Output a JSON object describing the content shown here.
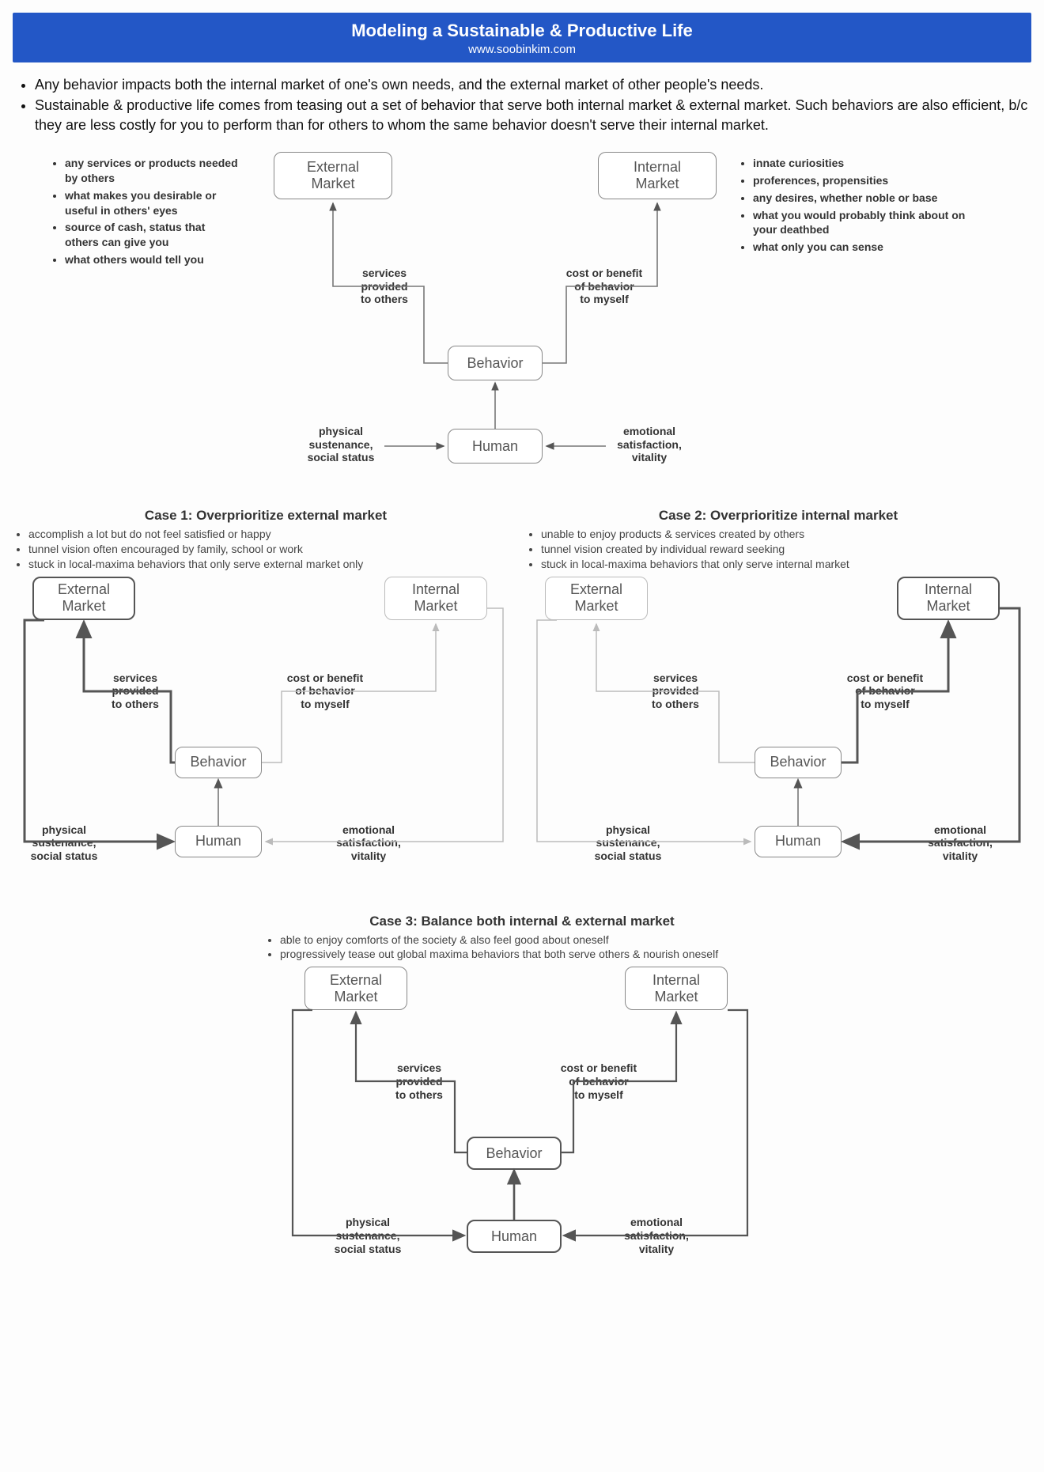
{
  "header": {
    "title": "Modeling a Sustainable & Productive Life",
    "url": "www.soobinkim.com"
  },
  "intro": [
    "Any behavior impacts both the internal market of one's own needs, and the external market of other people's needs.",
    "Sustainable & productive life comes from teasing out a set of behavior that serve both internal market & external market. Such behaviors are also efficient, b/c they are less costly for you to perform than for others to whom the same behavior doesn't serve their internal market."
  ],
  "nodes": {
    "external": "External\nMarket",
    "internal": "Internal\nMarket",
    "behavior": "Behavior",
    "human": "Human"
  },
  "edges": {
    "services": "services\nprovided\nto others",
    "cost": "cost or benefit\nof behavior\nto myself",
    "physical": "physical\nsustenance,\nsocial status",
    "emotional": "emotional\nsatisfaction,\nvitality"
  },
  "side_left": [
    "any services or products needed by others",
    "what makes you desirable or useful in others' eyes",
    "source of cash, status that others can give you",
    "what others would tell you"
  ],
  "side_right": [
    "innate curiosities",
    "proferences, propensities",
    "any desires, whether noble or base",
    "what you would probably think about on your deathbed",
    "what only you can sense"
  ],
  "cases": {
    "c1": {
      "title": "Case 1: Overprioritize external market",
      "bullets": [
        "accomplish a lot but do not feel satisfied or happy",
        "tunnel vision often encouraged by family, school or work",
        "stuck in local-maxima behaviors that only serve external market only"
      ]
    },
    "c2": {
      "title": "Case 2: Overprioritize internal market",
      "bullets": [
        "unable to enjoy products & services created by others",
        "tunnel vision created by individual reward seeking",
        "stuck in local-maxima behaviors that only serve internal market"
      ]
    },
    "c3": {
      "title": "Case 3: Balance both internal & external market",
      "bullets": [
        "able to enjoy comforts of the society & also feel good about oneself",
        "progressively tease out global maxima behaviors that both serve others & nourish oneself"
      ]
    }
  },
  "chart_data": {
    "type": "diagram",
    "nodes": [
      "External Market",
      "Internal Market",
      "Behavior",
      "Human"
    ],
    "edges": [
      {
        "from": "Behavior",
        "to": "External Market",
        "label": "services provided to others"
      },
      {
        "from": "Behavior",
        "to": "Internal Market",
        "label": "cost or benefit of behavior to myself"
      },
      {
        "from": "Human",
        "to": "Behavior",
        "label": ""
      },
      {
        "from": "External Market",
        "to": "Human",
        "label": "physical sustenance, social status"
      },
      {
        "from": "Internal Market",
        "to": "Human",
        "label": "emotional satisfaction, vitality"
      }
    ],
    "scenarios": [
      {
        "name": "Case 1",
        "emphasis": [
          "External Market→Human",
          "Behavior→External Market"
        ]
      },
      {
        "name": "Case 2",
        "emphasis": [
          "Internal Market→Human",
          "Behavior→Internal Market"
        ]
      },
      {
        "name": "Case 3",
        "emphasis": [
          "all balanced (behavior & human emphasized)"
        ]
      }
    ]
  }
}
